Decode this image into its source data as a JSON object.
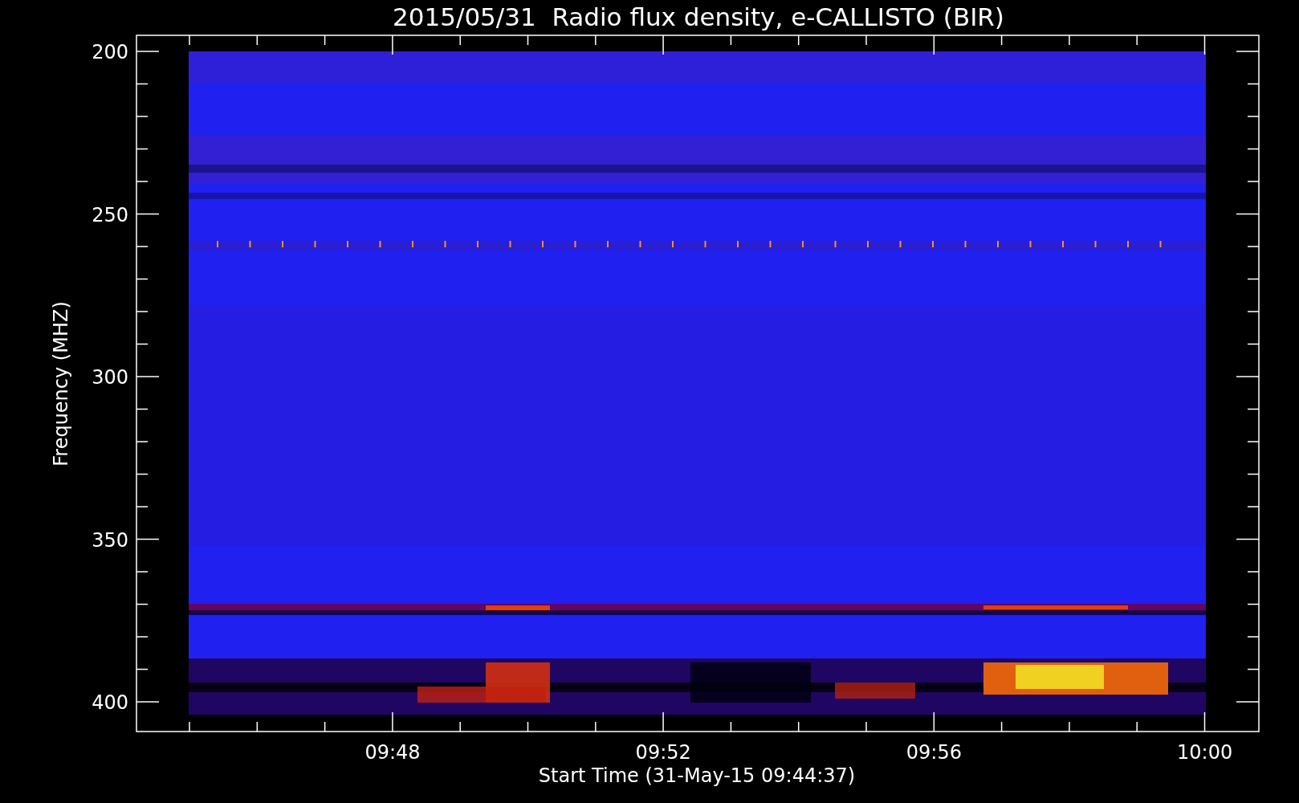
{
  "plot": {
    "title": "2015/05/31  Radio flux density, e-CALLISTO (BIR)",
    "ylabel": "Frequency (MHZ)",
    "yticks": [
      "200",
      "250",
      "300",
      "350",
      "400"
    ],
    "xticks": [
      "09:48",
      "09:52",
      "09:56",
      "10:00"
    ],
    "xlabel": "Start Time (31-May-15 09:44:37)"
  }
}
